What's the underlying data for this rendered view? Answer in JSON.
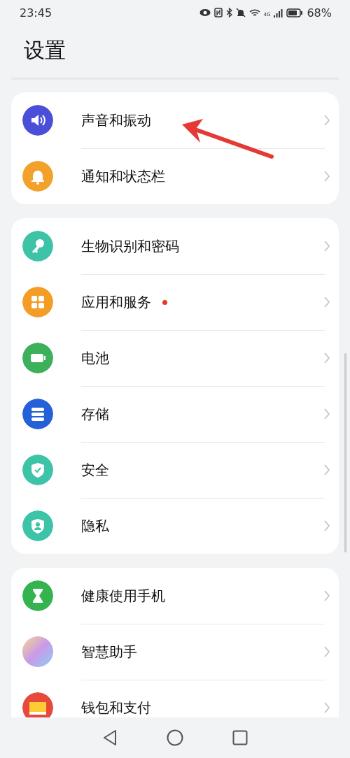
{
  "status_bar": {
    "time": "23:45",
    "network": "4G",
    "battery": "68%"
  },
  "title": "设置",
  "groups": [
    {
      "items": [
        {
          "label": "声音和振动",
          "kind": "speaker",
          "color": "#4b4fd8",
          "badge": false
        },
        {
          "label": "通知和状态栏",
          "kind": "bell",
          "color": "#f2a12a",
          "badge": false
        }
      ]
    },
    {
      "items": [
        {
          "label": "生物识别和密码",
          "kind": "key",
          "color": "#3cc3a8",
          "badge": false
        },
        {
          "label": "应用和服务",
          "kind": "grid",
          "color": "#f39c26",
          "badge": true
        },
        {
          "label": "电池",
          "kind": "battery",
          "color": "#3cb05a",
          "badge": false
        },
        {
          "label": "存储",
          "kind": "storage",
          "color": "#2460d8",
          "badge": false
        },
        {
          "label": "安全",
          "kind": "shield",
          "color": "#3cc3a8",
          "badge": false
        },
        {
          "label": "隐私",
          "kind": "privacy",
          "color": "#3cc3a8",
          "badge": false
        }
      ]
    },
    {
      "items": [
        {
          "label": "健康使用手机",
          "kind": "hourglass",
          "color": "#35b34f",
          "badge": false
        },
        {
          "label": "智慧助手",
          "kind": "orb",
          "color": "#c9a0e8",
          "badge": false
        },
        {
          "label": "钱包和支付",
          "kind": "wallet",
          "color": "#e54a3c",
          "badge": false
        }
      ]
    }
  ]
}
